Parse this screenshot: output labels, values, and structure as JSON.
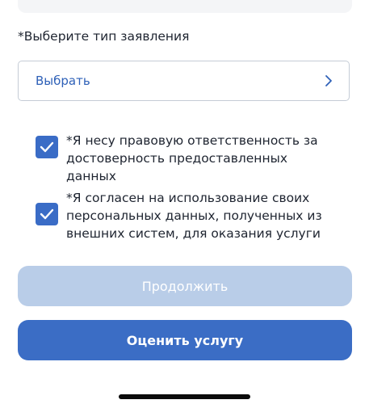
{
  "form": {
    "type_label": "*Выберите тип заявления",
    "type_select_value": "Выбрать"
  },
  "checkboxes": [
    {
      "text": "*Я несу правовую ответственность за достоверность предоставленных данных",
      "checked": true
    },
    {
      "text": "*Я согласен на использование своих персональных данных, полученных из внешних систем, для оказания услуги",
      "checked": true
    }
  ],
  "buttons": {
    "continue_label": "Продолжить",
    "rate_label": "Оценить услугу"
  },
  "colors": {
    "accent": "#3b6dc5",
    "disabled": "#b9cde8",
    "link": "#2f61b8"
  },
  "icons": {
    "select_arrow": "chevron-right-icon",
    "checkbox_mark": "checkmark-icon"
  }
}
